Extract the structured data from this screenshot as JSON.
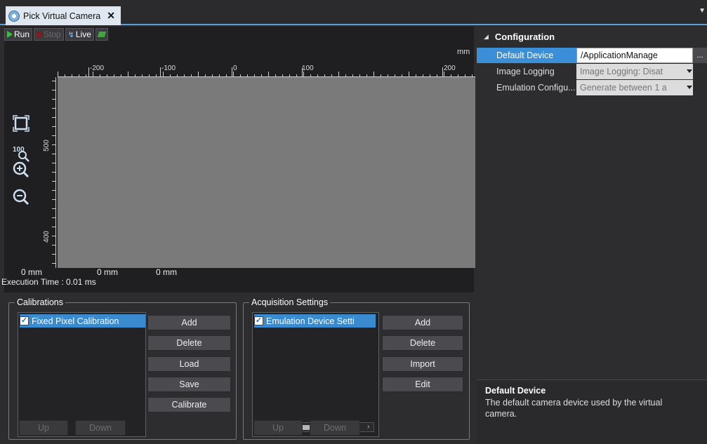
{
  "tab": {
    "title": "Pick Virtual Camera",
    "close": "✕"
  },
  "toolbar": {
    "run": "Run",
    "stop": "Stop",
    "live": "Live"
  },
  "ruler": {
    "unit": "mm",
    "top_labels": [
      "-200",
      "-100",
      "0",
      "100",
      "200"
    ],
    "left_labels": [
      "500",
      "400"
    ]
  },
  "coords": [
    "0 mm",
    "0 mm",
    "0 mm"
  ],
  "execution_time": "Execution Time : 0.01 ms",
  "calibrations": {
    "title": "Calibrations",
    "items": [
      "Fixed Pixel Calibration"
    ],
    "buttons": [
      "Add",
      "Delete",
      "Load",
      "Save",
      "Calibrate"
    ],
    "up": "Up",
    "down": "Down"
  },
  "acquisition": {
    "title": "Acquisition Settings",
    "items": [
      "Emulation Device Setti"
    ],
    "buttons": [
      "Add",
      "Delete",
      "Import",
      "Edit"
    ],
    "up": "Up",
    "down": "Down"
  },
  "properties": {
    "category": "Configuration",
    "rows": [
      {
        "name": "Default Device",
        "value": "/ApplicationManage",
        "ellipsis": "..."
      },
      {
        "name": "Image Logging",
        "value": "Image Logging: Disat"
      },
      {
        "name": "Emulation Configu...",
        "value": "Generate between 1 a"
      }
    ]
  },
  "description": {
    "title": "Default Device",
    "text": "The default camera device used by the virtual camera."
  },
  "colors": {
    "accent": "#3a8ad0",
    "selected_row": "#3b8fd6",
    "canvas": "#7a7a7a"
  }
}
